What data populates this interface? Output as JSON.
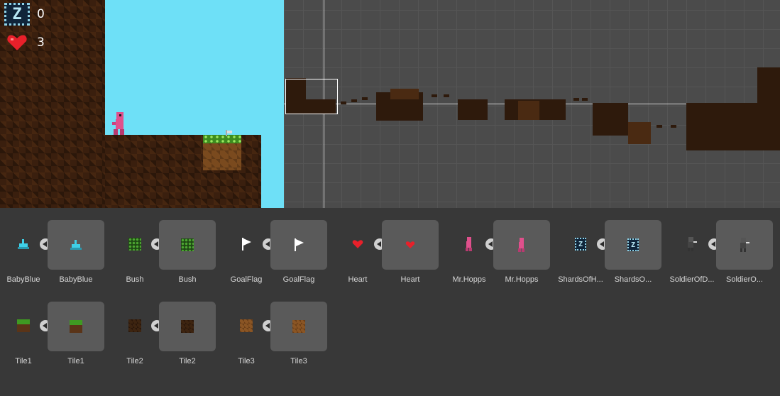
{
  "hud": {
    "shards_count": "0",
    "lives_count": "3"
  },
  "colors": {
    "sky": "#6ee0f7",
    "scene_bg": "#4b4b4b",
    "panel_bg": "#383838"
  },
  "assets": [
    {
      "name_small": "BabyBlue",
      "name_big": "BabyBlue",
      "icon": "baby-blue-sprite-icon"
    },
    {
      "name_small": "Bush",
      "name_big": "Bush",
      "icon": "bush-sprite-icon"
    },
    {
      "name_small": "GoalFlag",
      "name_big": "GoalFlag",
      "icon": "goal-flag-icon"
    },
    {
      "name_small": "Heart",
      "name_big": "Heart",
      "icon": "heart-icon"
    },
    {
      "name_small": "Mr.Hopps",
      "name_big": "Mr.Hopps",
      "icon": "mr-hopps-sprite-icon"
    },
    {
      "name_small": "ShardsOfH...",
      "name_big": "ShardsO...",
      "icon": "shard-z-icon"
    },
    {
      "name_small": "SoldierOfD...",
      "name_big": "SoldierO...",
      "icon": "soldier-sprite-icon"
    },
    {
      "name_small": "Tile1",
      "name_big": "Tile1",
      "icon": "grass-tile-icon"
    },
    {
      "name_small": "Tile2",
      "name_big": "Tile2",
      "icon": "dark-dirt-tile-icon"
    },
    {
      "name_small": "Tile3",
      "name_big": "Tile3",
      "icon": "light-dirt-tile-icon"
    }
  ]
}
